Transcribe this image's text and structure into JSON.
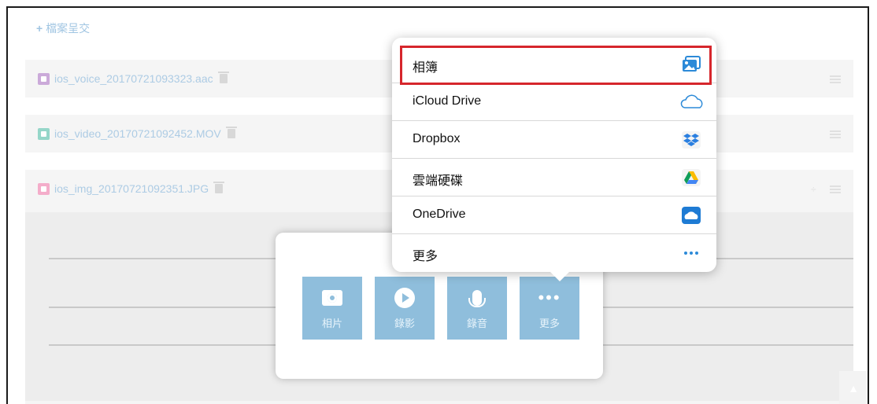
{
  "page": {
    "add_link": "檔案呈交"
  },
  "files": [
    {
      "name": "ios_voice_20170721093323.aac",
      "type": "voice"
    },
    {
      "name": "ios_video_20170721092452.MOV",
      "type": "video"
    },
    {
      "name": "ios_img_20170721092351.JPG",
      "type": "img"
    }
  ],
  "picker": {
    "buttons": [
      {
        "label": "相片",
        "icon": "camera-icon"
      },
      {
        "label": "錄影",
        "icon": "play-icon"
      },
      {
        "label": "錄音",
        "icon": "mic-icon"
      },
      {
        "label": "更多",
        "icon": "more-icon"
      }
    ]
  },
  "menu": {
    "items": [
      {
        "label": "相簿",
        "icon": "photos-icon",
        "highlighted": true
      },
      {
        "label": "iCloud Drive",
        "icon": "icloud-icon"
      },
      {
        "label": "Dropbox",
        "icon": "dropbox-icon"
      },
      {
        "label": "雲端硬碟",
        "icon": "google-drive-icon"
      },
      {
        "label": "OneDrive",
        "icon": "onedrive-icon"
      },
      {
        "label": "更多",
        "icon": "more-dots-icon"
      }
    ]
  },
  "colors": {
    "accent": "#2f7fc1",
    "highlight_border": "#d6262c",
    "picker_button": "#8fbedc"
  }
}
